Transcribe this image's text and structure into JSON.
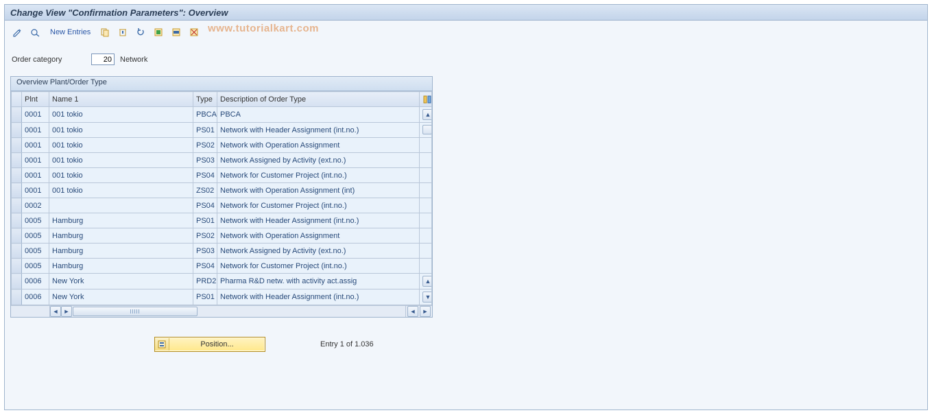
{
  "title": "Change View \"Confirmation Parameters\": Overview",
  "toolbar": {
    "new_entries_label": "New Entries"
  },
  "watermark": "www.tutorialkart.com",
  "order_category": {
    "label": "Order category",
    "value": "20",
    "text": "Network"
  },
  "group_title": "Overview Plant/Order Type",
  "columns": {
    "plnt": "Plnt",
    "name": "Name 1",
    "type": "Type",
    "desc": "Description of Order Type"
  },
  "rows": [
    {
      "plnt": "0001",
      "name": "001 tokio",
      "type": "PBCA",
      "desc": "PBCA"
    },
    {
      "plnt": "0001",
      "name": "001 tokio",
      "type": "PS01",
      "desc": "Network with Header Assignment (int.no.)"
    },
    {
      "plnt": "0001",
      "name": "001 tokio",
      "type": "PS02",
      "desc": "Network with Operation Assignment"
    },
    {
      "plnt": "0001",
      "name": "001 tokio",
      "type": "PS03",
      "desc": "Network Assigned by Activity (ext.no.)"
    },
    {
      "plnt": "0001",
      "name": "001 tokio",
      "type": "PS04",
      "desc": "Network for Customer Project (int.no.)"
    },
    {
      "plnt": "0001",
      "name": "001 tokio",
      "type": "ZS02",
      "desc": "Network with Operation Assignment (int)"
    },
    {
      "plnt": "0002",
      "name": "",
      "type": "PS04",
      "desc": "Network for Customer Project (int.no.)"
    },
    {
      "plnt": "0005",
      "name": "Hamburg",
      "type": "PS01",
      "desc": "Network with Header Assignment (int.no.)"
    },
    {
      "plnt": "0005",
      "name": "Hamburg",
      "type": "PS02",
      "desc": "Network with Operation Assignment"
    },
    {
      "plnt": "0005",
      "name": "Hamburg",
      "type": "PS03",
      "desc": "Network Assigned by Activity (ext.no.)"
    },
    {
      "plnt": "0005",
      "name": "Hamburg",
      "type": "PS04",
      "desc": "Network for Customer Project (int.no.)"
    },
    {
      "plnt": "0006",
      "name": "New York",
      "type": "PRD2",
      "desc": "Pharma R&D netw. with activity act.assig"
    },
    {
      "plnt": "0006",
      "name": "New York",
      "type": "PS01",
      "desc": "Network with Header Assignment (int.no.)"
    }
  ],
  "footer": {
    "position_label": "Position...",
    "entry_text": "Entry 1 of 1.036"
  }
}
